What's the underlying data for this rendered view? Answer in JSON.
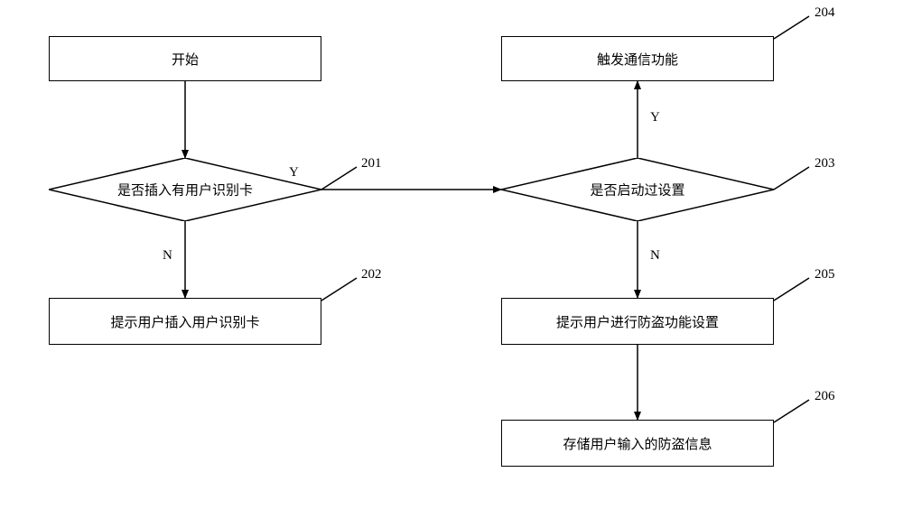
{
  "chart_data": {
    "type": "flowchart",
    "nodes": [
      {
        "id": "start",
        "shape": "rect",
        "label": "开始"
      },
      {
        "id": "201",
        "shape": "diamond",
        "label": "是否插入有用户识别卡",
        "ref": "201"
      },
      {
        "id": "202",
        "shape": "rect",
        "label": "提示用户插入用户识别卡",
        "ref": "202"
      },
      {
        "id": "203",
        "shape": "diamond",
        "label": "是否启动过设置",
        "ref": "203"
      },
      {
        "id": "204",
        "shape": "rect",
        "label": "触发通信功能",
        "ref": "204"
      },
      {
        "id": "205",
        "shape": "rect",
        "label": "提示用户进行防盗功能设置",
        "ref": "205"
      },
      {
        "id": "206",
        "shape": "rect",
        "label": "存储用户输入的防盗信息",
        "ref": "206"
      }
    ],
    "edges": [
      {
        "from": "start",
        "to": "201"
      },
      {
        "from": "201",
        "to": "202",
        "label": "N"
      },
      {
        "from": "201",
        "to": "203",
        "label": "Y"
      },
      {
        "from": "203",
        "to": "204",
        "label": "Y"
      },
      {
        "from": "203",
        "to": "205",
        "label": "N"
      },
      {
        "from": "205",
        "to": "206"
      }
    ]
  },
  "boxes": {
    "start": "开始",
    "d201": "是否插入有用户识别卡",
    "b202": "提示用户插入用户识别卡",
    "d203": "是否启动过设置",
    "b204": "触发通信功能",
    "b205": "提示用户进行防盗功能设置",
    "b206": "存储用户输入的防盗信息"
  },
  "refs": {
    "r201": "201",
    "r202": "202",
    "r203": "203",
    "r204": "204",
    "r205": "205",
    "r206": "206"
  },
  "edgeLabels": {
    "y1": "Y",
    "n1": "N",
    "y2": "Y",
    "n2": "N"
  }
}
